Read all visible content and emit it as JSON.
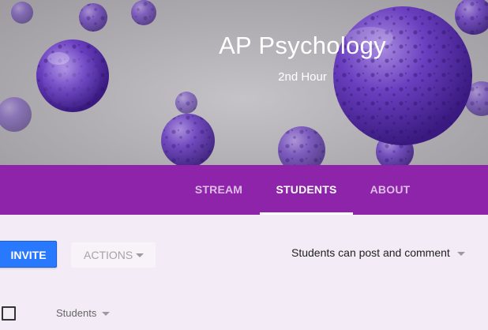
{
  "course": {
    "title": "AP Psychology",
    "section": "2nd Hour"
  },
  "tabs": [
    {
      "label": "STREAM",
      "active": false
    },
    {
      "label": "STUDENTS",
      "active": true
    },
    {
      "label": "ABOUT",
      "active": false
    }
  ],
  "toolbar": {
    "invite_label": "INVITE",
    "actions_label": "ACTIONS",
    "permission_setting": "Students can post and comment"
  },
  "list": {
    "sort_label": "Students"
  },
  "icons": {
    "actions_dropdown": "caret-down-icon",
    "permission_dropdown": "caret-down-icon",
    "sort_dropdown": "caret-down-icon",
    "select_all": "checkbox-icon"
  },
  "colors": {
    "accent": "#8e24aa",
    "primary_button": "#2979ff",
    "page_background": "#f3ebf5"
  }
}
